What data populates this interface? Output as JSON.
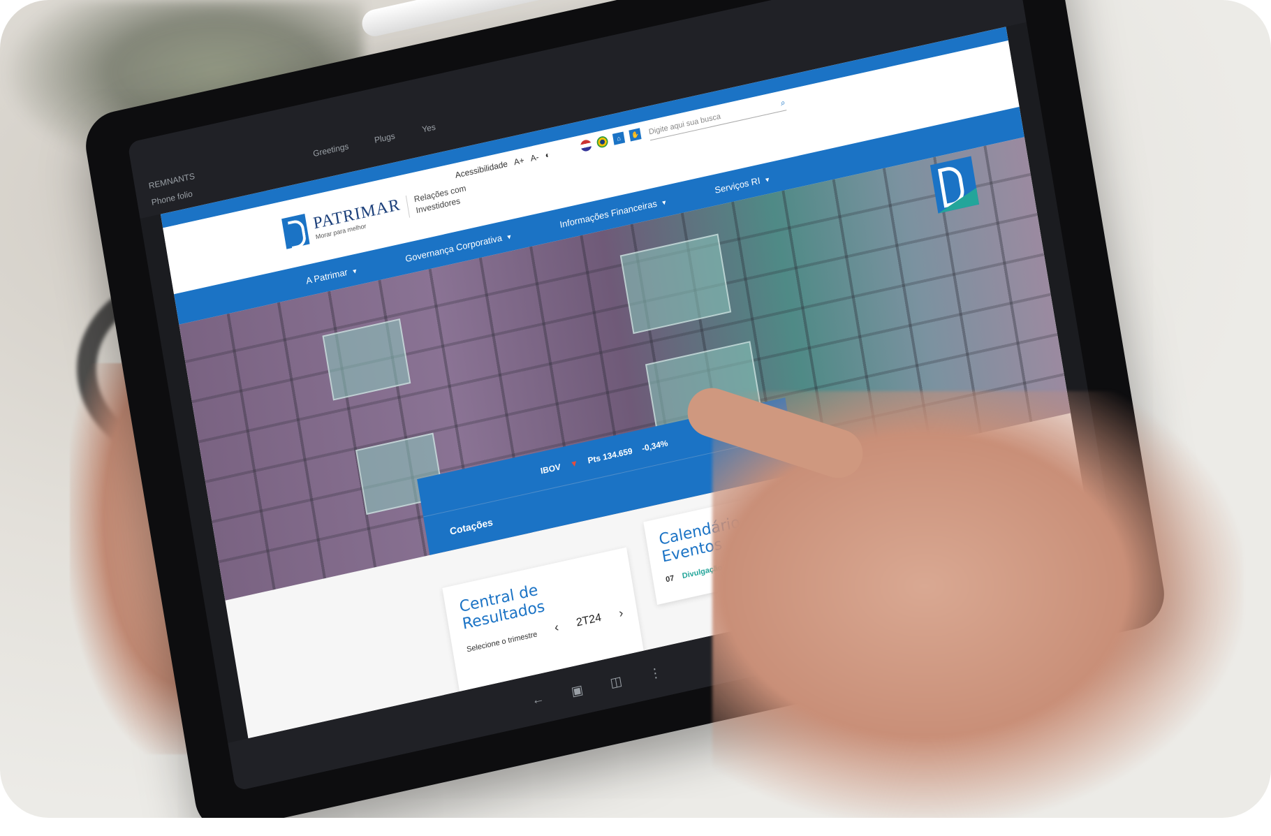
{
  "device_topbar": {
    "left_1": "REMNANTS",
    "left_2": "Phone folio",
    "items": [
      "Greetings",
      "Plugs",
      "Yes"
    ]
  },
  "site": {
    "brand": "PATRIMAR",
    "brand_tagline": "Morar para melhor",
    "section_label": "Relações com Investidores",
    "accessibility": {
      "label": "Acessibilidade",
      "increase": "A+",
      "decrease": "A-"
    },
    "search_placeholder": "Digite aqui sua busca",
    "nav": [
      {
        "label": "A Patrimar"
      },
      {
        "label": "Governança Corporativa"
      },
      {
        "label": "Informações Financeiras"
      },
      {
        "label": "Serviços RI"
      }
    ]
  },
  "ticker": {
    "index": "IBOV",
    "points": "Pts 134.659",
    "change": "-0,34%"
  },
  "quotes": {
    "title": "Cotações"
  },
  "results": {
    "title": "Central de Resultados",
    "select_label": "Selecione o trimestre",
    "quarter": "2T24"
  },
  "events": {
    "title": "Calendário de Eventos",
    "items": [
      {
        "day": "07",
        "name": "Divulgação de Resultado"
      }
    ]
  },
  "colors": {
    "brand_blue": "#1b73c5",
    "accent_teal": "#23a59a",
    "down_red": "#e74c3c"
  }
}
